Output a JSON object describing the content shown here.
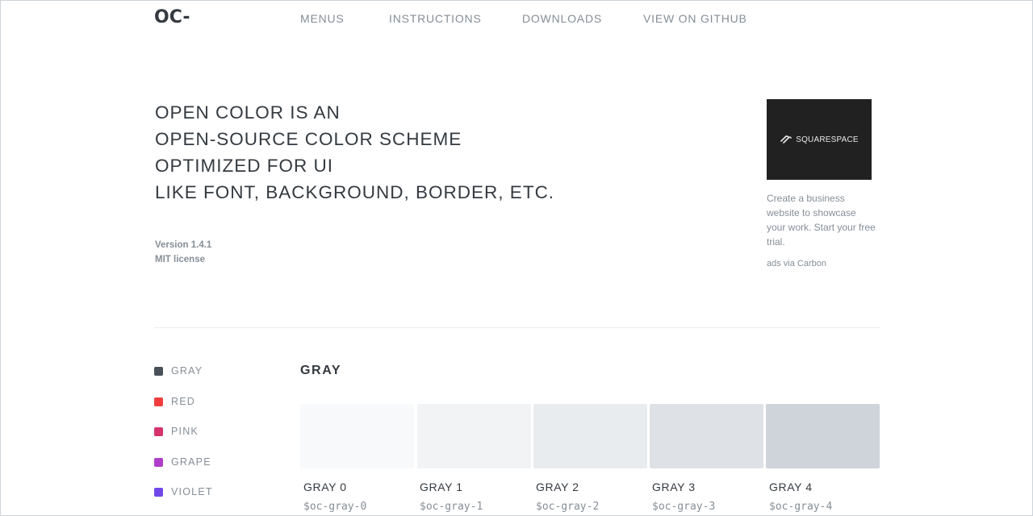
{
  "header": {
    "logo": "OC-",
    "nav": [
      "MENUS",
      "INSTRUCTIONS",
      "DOWNLOADS",
      "VIEW ON GITHUB"
    ]
  },
  "hero": {
    "lines": [
      "OPEN COLOR IS AN",
      "OPEN-SOURCE COLOR SCHEME",
      "OPTIMIZED FOR UI",
      "LIKE FONT, BACKGROUND, BORDER, ETC."
    ],
    "version": "Version 1.4.1",
    "license": "MIT license"
  },
  "ad": {
    "brand": "SQUARESPACE",
    "text": "Create a business website to showcase your work. Start your free trial.",
    "via": "ads via Carbon"
  },
  "sidebar": {
    "items": [
      {
        "label": "GRAY",
        "color": "#495057"
      },
      {
        "label": "RED",
        "color": "#f03e3e"
      },
      {
        "label": "PINK",
        "color": "#d6336c"
      },
      {
        "label": "GRAPE",
        "color": "#ae3ec9"
      },
      {
        "label": "VIOLET",
        "color": "#7048e8"
      }
    ]
  },
  "section": {
    "title": "GRAY",
    "swatches": [
      {
        "name": "GRAY 0",
        "var": "$oc-gray-0",
        "color": "#f8f9fa"
      },
      {
        "name": "GRAY 1",
        "var": "$oc-gray-1",
        "color": "#f1f3f5"
      },
      {
        "name": "GRAY 2",
        "var": "$oc-gray-2",
        "color": "#e9ecef"
      },
      {
        "name": "GRAY 3",
        "var": "$oc-gray-3",
        "color": "#dee2e6"
      },
      {
        "name": "GRAY 4",
        "var": "$oc-gray-4",
        "color": "#ced4da"
      }
    ]
  }
}
